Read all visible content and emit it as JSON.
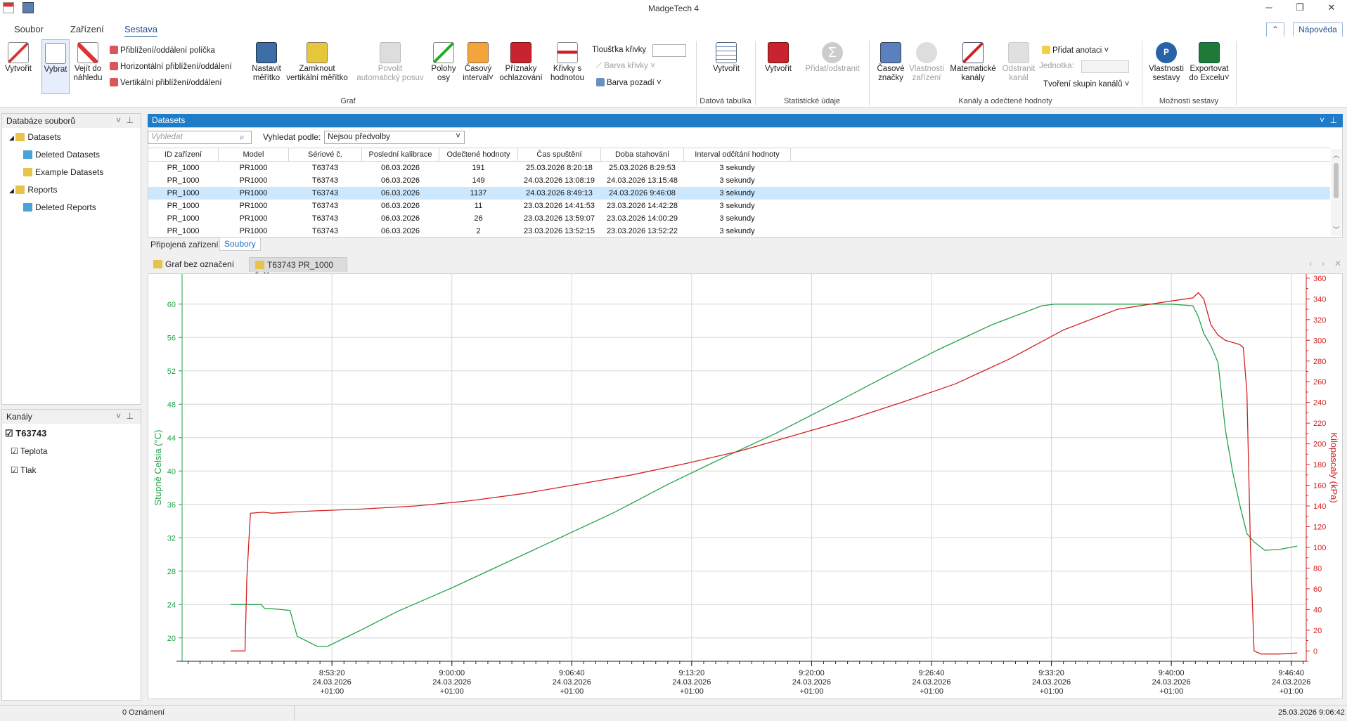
{
  "window": {
    "title": "MadgeTech 4"
  },
  "menu": {
    "items": [
      "Soubor",
      "Zařízení",
      "Sestava"
    ],
    "help": "Nápověda"
  },
  "ribbon": {
    "create": "Vytvořit",
    "select": "Vybrat",
    "fit_preview": [
      "Vejít do",
      "náhledu"
    ],
    "zoom_box": "Přiblížení/oddálení políčka",
    "zoom_h": "Horizontální přiblížení/oddálení",
    "zoom_v": "Vertikální přiblížení/oddálení",
    "set_scale": [
      "Nastavit",
      "měřítko"
    ],
    "lock_scale": [
      "Zamknout",
      "vertikální měřítko"
    ],
    "autoscroll": [
      "Povolit",
      "automatický posuv"
    ],
    "axis_pos": [
      "Polohy",
      "osy"
    ],
    "time_interval": [
      "Časový",
      "interval"
    ],
    "cooling": [
      "Příznaky",
      "ochlazování"
    ],
    "curves_value": [
      "Křivky s",
      "hodnotou"
    ],
    "line_thickness": "Tloušťka křivky",
    "curve_color": "Barva křivky",
    "bg_color": "Barva pozadí",
    "group_graph": "Graf",
    "table_create": "Vytvořit",
    "group_table": "Datová tabulka",
    "stat_create": "Vytvořit",
    "stat_addremove": "Přidat/odstranit",
    "group_stats": "Statistické údaje",
    "time_marks": [
      "Časové",
      "značky"
    ],
    "device_props": [
      "Vlastnosti",
      "zařízení"
    ],
    "math_channels": [
      "Matematické",
      "kanály"
    ],
    "remove_channel": [
      "Odstranit",
      "kanál"
    ],
    "add_annotation": "Přidat anotaci",
    "unit": "Jednotka:",
    "channel_groups": "Tvoření skupin kanálů",
    "group_channels": "Kanály a odečtené hodnoty",
    "report_props": [
      "Vlastnosti",
      "sestavy"
    ],
    "export_excel": [
      "Exportovat",
      "do Excelu"
    ],
    "group_report": "Možnosti sestavy"
  },
  "file_db": {
    "title": "Databáze souborů",
    "items": [
      {
        "label": "Datasets",
        "level": 0
      },
      {
        "label": "Deleted Datasets",
        "level": 1
      },
      {
        "label": "Example Datasets",
        "level": 1
      },
      {
        "label": "Reports",
        "level": 0
      },
      {
        "label": "Deleted Reports",
        "level": 1
      }
    ]
  },
  "channels": {
    "title": "Kanály",
    "device": "T63743",
    "items": [
      "Teplota",
      "Tlak"
    ]
  },
  "datasets": {
    "title": "Datasets",
    "search_placeholder": "Vyhledat",
    "search_by_label": "Vyhledat podle:",
    "search_by_value": "Nejsou předvolby",
    "columns": [
      "ID zařízení",
      "Model",
      "Sériové č.",
      "Poslední kalibrace",
      "Odečtené hodnoty",
      "Čas spuštění",
      "Doba stahování",
      "Interval odčítání hodnoty"
    ],
    "rows": [
      [
        "PR_1000",
        "PR1000",
        "T63743",
        "06.03.2026",
        "191",
        "25.03.2026 8:20:18",
        "25.03.2026 8:29:53",
        "3 sekundy"
      ],
      [
        "PR_1000",
        "PR1000",
        "T63743",
        "06.03.2026",
        "149",
        "24.03.2026 13:08:19",
        "24.03.2026 13:15:48",
        "3 sekundy"
      ],
      [
        "PR_1000",
        "PR1000",
        "T63743",
        "06.03.2026",
        "1137",
        "24.03.2026 8:49:13",
        "24.03.2026 9:46:08",
        "3 sekundy"
      ],
      [
        "PR_1000",
        "PR1000",
        "T63743",
        "06.03.2026",
        "11",
        "23.03.2026 14:41:53",
        "23.03.2026 14:42:28",
        "3 sekundy"
      ],
      [
        "PR_1000",
        "PR1000",
        "T63743",
        "06.03.2026",
        "26",
        "23.03.2026 13:59:07",
        "23.03.2026 14:00:29",
        "3 sekundy"
      ],
      [
        "PR_1000",
        "PR1000",
        "T63743",
        "06.03.2026",
        "2",
        "23.03.2026 13:52:15",
        "23.03.2026 13:52:22",
        "3 sekundy"
      ]
    ],
    "selected_row": 2,
    "bottom_tabs": [
      "Připojená zařízení",
      "Soubory"
    ]
  },
  "doc_tabs": [
    "Graf bez označení",
    "T63743 PR_1000 *"
  ],
  "status": {
    "notifications": "0 Oznámení",
    "datetime": "25.03.2026 9:06:42"
  },
  "colors": {
    "accent": "#1e7cc8",
    "temp": "#22a34a",
    "pressure": "#d32020"
  },
  "chart_data": {
    "type": "line",
    "ylabel": "Stupně Celsia (°C)",
    "y2label": "Kilopascaly (kPa)",
    "ylim": [
      17.2,
      63.6
    ],
    "y2lim": [
      -10,
      364
    ],
    "yticks": [
      20,
      24,
      28,
      32,
      36,
      40,
      44,
      48,
      52,
      56,
      60
    ],
    "y2ticks": [
      0,
      20,
      40,
      60,
      80,
      100,
      120,
      140,
      160,
      180,
      200,
      220,
      240,
      260,
      280,
      300,
      320,
      340,
      360
    ],
    "xlim_min": [
      525.0,
      587.5
    ],
    "xticks": [
      {
        "min": 533.333,
        "label": [
          "8:53:20",
          "24.03.2026",
          "+01:00"
        ]
      },
      {
        "min": 540.0,
        "label": [
          "9:00:00",
          "24.03.2026",
          "+01:00"
        ]
      },
      {
        "min": 546.667,
        "label": [
          "9:06:40",
          "24.03.2026",
          "+01:00"
        ]
      },
      {
        "min": 553.333,
        "label": [
          "9:13:20",
          "24.03.2026",
          "+01:00"
        ]
      },
      {
        "min": 560.0,
        "label": [
          "9:20:00",
          "24.03.2026",
          "+01:00"
        ]
      },
      {
        "min": 566.667,
        "label": [
          "9:26:40",
          "24.03.2026",
          "+01:00"
        ]
      },
      {
        "min": 573.333,
        "label": [
          "9:33:20",
          "24.03.2026",
          "+01:00"
        ]
      },
      {
        "min": 580.0,
        "label": [
          "9:40:00",
          "24.03.2026",
          "+01:00"
        ]
      },
      {
        "min": 586.667,
        "label": [
          "9:46:40",
          "24.03.2026",
          "+01:00"
        ]
      }
    ],
    "series": [
      {
        "name": "Teplota",
        "axis": "left",
        "x": [
          527.7,
          529.4,
          529.6,
          530.0,
          531.0,
          531.4,
          532.5,
          533.1,
          535.0,
          537.0,
          540.0,
          543.0,
          546.0,
          549.0,
          552.0,
          555.0,
          558.0,
          561.0,
          564.0,
          567.0,
          570.0,
          572.8,
          573.5,
          574.5,
          576.0,
          578.0,
          580.0,
          581.2,
          581.5,
          581.8,
          582.2,
          582.6,
          583.0,
          583.4,
          583.8,
          584.2,
          584.6,
          585.2,
          586.0,
          587.0
        ],
        "y": [
          24.0,
          24.0,
          23.5,
          23.5,
          23.3,
          20.2,
          19.0,
          19.0,
          21.0,
          23.2,
          26.0,
          29.0,
          32.0,
          35.0,
          38.4,
          41.5,
          44.5,
          47.8,
          51.2,
          54.5,
          57.5,
          59.8,
          60.0,
          60.0,
          60.0,
          60.0,
          60.0,
          59.8,
          58.5,
          56.5,
          55.0,
          53.0,
          45.0,
          40.0,
          36.0,
          32.5,
          31.5,
          30.5,
          30.6,
          31.0
        ]
      },
      {
        "name": "Tlak",
        "axis": "right",
        "x": [
          527.7,
          528.5,
          528.6,
          528.8,
          529.5,
          530.0,
          531.0,
          532.0,
          535.0,
          538.0,
          541.0,
          544.0,
          547.0,
          550.0,
          553.0,
          556.0,
          559.0,
          562.0,
          565.0,
          568.0,
          571.0,
          574.0,
          577.0,
          580.0,
          581.2,
          581.5,
          581.8,
          582.2,
          582.6,
          583.0,
          583.4,
          583.8,
          584.0,
          584.2,
          584.4,
          584.6,
          585.0,
          586.0,
          587.0
        ],
        "y": [
          0,
          0,
          70,
          133,
          134,
          133,
          134,
          135,
          137,
          140,
          145,
          152,
          161,
          170,
          181,
          193,
          208,
          223,
          240,
          258,
          282,
          310,
          330,
          338,
          341,
          346,
          340,
          315,
          305,
          300,
          298,
          296,
          293,
          250,
          100,
          0,
          -3,
          -3,
          -2
        ]
      }
    ]
  }
}
